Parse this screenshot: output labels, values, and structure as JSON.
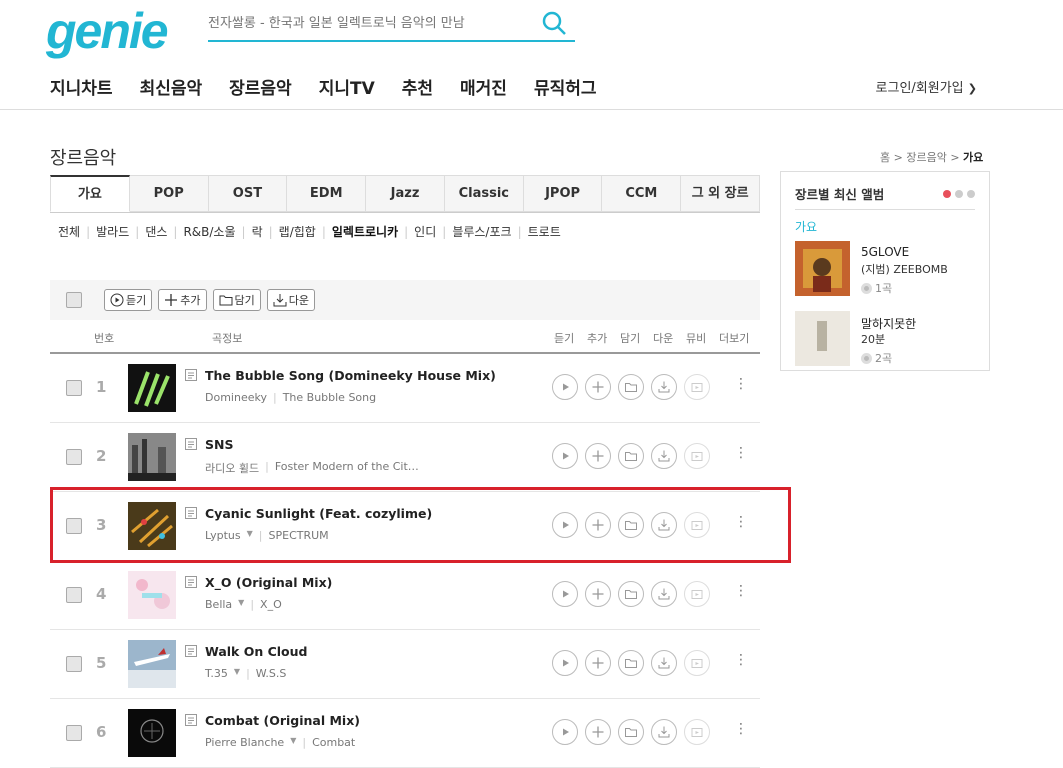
{
  "logo": "genie",
  "search": {
    "placeholder": "전자쌀롱 - 한국과 일본 일렉트로닉 음악의 만남"
  },
  "gnb": [
    "지니차트",
    "최신음악",
    "장르음악",
    "지니TV",
    "추천",
    "매거진",
    "뮤직허그"
  ],
  "login": "로그인/회원가입",
  "page_title": "장르음악",
  "breadcrumb": {
    "home": "홈",
    "section": "장르음악",
    "current": "가요"
  },
  "tabs": [
    "가요",
    "POP",
    "OST",
    "EDM",
    "Jazz",
    "Classic",
    "JPOP",
    "CCM",
    "그 외 장르"
  ],
  "subgenres": [
    "전체",
    "발라드",
    "댄스",
    "R&B/소울",
    "락",
    "랩/힙합",
    "일렉트로니카",
    "인디",
    "블루스/포크",
    "트로트"
  ],
  "toolbar": {
    "play": "듣기",
    "add": "추가",
    "save": "담기",
    "download": "다운"
  },
  "list_head": {
    "number": "번호",
    "info": "곡정보",
    "play": "듣기",
    "add": "추가",
    "save": "담기",
    "download": "다운",
    "mv": "뮤비",
    "more": "더보기"
  },
  "songs": [
    {
      "num": "1",
      "title": "The Bubble Song (Domineeky House Mix)",
      "artist": "Domineeky",
      "album": "The Bubble Song",
      "dropdown": false
    },
    {
      "num": "2",
      "title": "SNS",
      "artist": "라디오 휠드",
      "album": "Foster Modern of the Cit…",
      "dropdown": false
    },
    {
      "num": "3",
      "title": "Cyanic Sunlight (Feat. cozylime)",
      "artist": "Lyptus",
      "album": "SPECTRUM",
      "dropdown": true
    },
    {
      "num": "4",
      "title": "X_O (Original Mix)",
      "artist": "Bella",
      "album": "X_O",
      "dropdown": true
    },
    {
      "num": "5",
      "title": "Walk On Cloud",
      "artist": "T.35",
      "album": "W.S.S",
      "dropdown": true
    },
    {
      "num": "6",
      "title": "Combat (Original Mix)",
      "artist": "Pierre Blanche",
      "album": "Combat",
      "dropdown": true
    }
  ],
  "aside": {
    "title": "장르별 최신 앨범",
    "genre": "가요",
    "albums": [
      {
        "title": "5GLOVE",
        "artist": "(지범) ZEEBOMB",
        "count": "1곡"
      },
      {
        "title": "말하지못한",
        "artist": "20분",
        "count": "2곡"
      }
    ]
  },
  "colors": {
    "brand": "#22b6d3",
    "highlight": "#d8212b",
    "dot_active": "#e8505b"
  }
}
